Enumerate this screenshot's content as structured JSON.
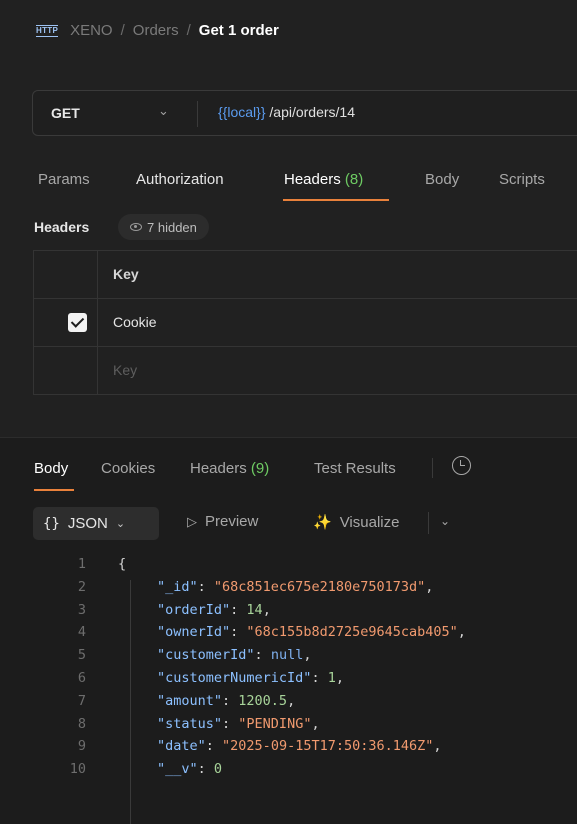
{
  "breadcrumb": {
    "icon": "http-icon",
    "icon_label": "HTTP",
    "items": [
      "XENO",
      "Orders"
    ],
    "separator": "/",
    "current": "Get 1 order"
  },
  "request": {
    "method": "GET",
    "url_variable": "{{local}}",
    "url_path": "/api/orders/14"
  },
  "request_tabs": {
    "params": "Params",
    "authorization": "Authorization",
    "headers": "Headers",
    "headers_count": "(8)",
    "body": "Body",
    "scripts": "Scripts"
  },
  "headers_section": {
    "label": "Headers",
    "hidden": "7 hidden",
    "column_key": "Key",
    "rows": [
      {
        "checked": true,
        "key": "Cookie"
      }
    ],
    "placeholder": "Key"
  },
  "response_tabs": {
    "body": "Body",
    "cookies": "Cookies",
    "headers": "Headers",
    "headers_count": "(9)",
    "test_results": "Test Results"
  },
  "response_toolbar": {
    "format_braces": "{}",
    "format": "JSON",
    "preview": "Preview",
    "visualize": "Visualize"
  },
  "response_body": [
    {
      "n": "1",
      "open": "{"
    },
    {
      "n": "2",
      "key": "\"_id\"",
      "value": "\"68c851ec675e2180e750173d\"",
      "type": "string",
      "comma": ","
    },
    {
      "n": "3",
      "key": "\"orderId\"",
      "value": "14",
      "type": "number",
      "comma": ","
    },
    {
      "n": "4",
      "key": "\"ownerId\"",
      "value": "\"68c155b8d2725e9645cab405\"",
      "type": "string",
      "comma": ","
    },
    {
      "n": "5",
      "key": "\"customerId\"",
      "value": "null",
      "type": "null",
      "comma": ","
    },
    {
      "n": "6",
      "key": "\"customerNumericId\"",
      "value": "1",
      "type": "number",
      "comma": ","
    },
    {
      "n": "7",
      "key": "\"amount\"",
      "value": "1200.5",
      "type": "number",
      "comma": ","
    },
    {
      "n": "8",
      "key": "\"status\"",
      "value": "\"PENDING\"",
      "type": "string",
      "comma": ","
    },
    {
      "n": "9",
      "key": "\"date\"",
      "value": "\"2025-09-15T17:50:36.146Z\"",
      "type": "string",
      "comma": ","
    },
    {
      "n": "10",
      "key": "\"__v\"",
      "value": "0",
      "type": "number",
      "comma": ""
    }
  ],
  "colors": {
    "background": "#212121",
    "accent": "#e9813b",
    "count_green": "#6ecb63",
    "variable_blue": "#5b9cf0",
    "json_key": "#8cc0ff",
    "json_string": "#f19a6f",
    "json_number": "#a8d49a"
  }
}
